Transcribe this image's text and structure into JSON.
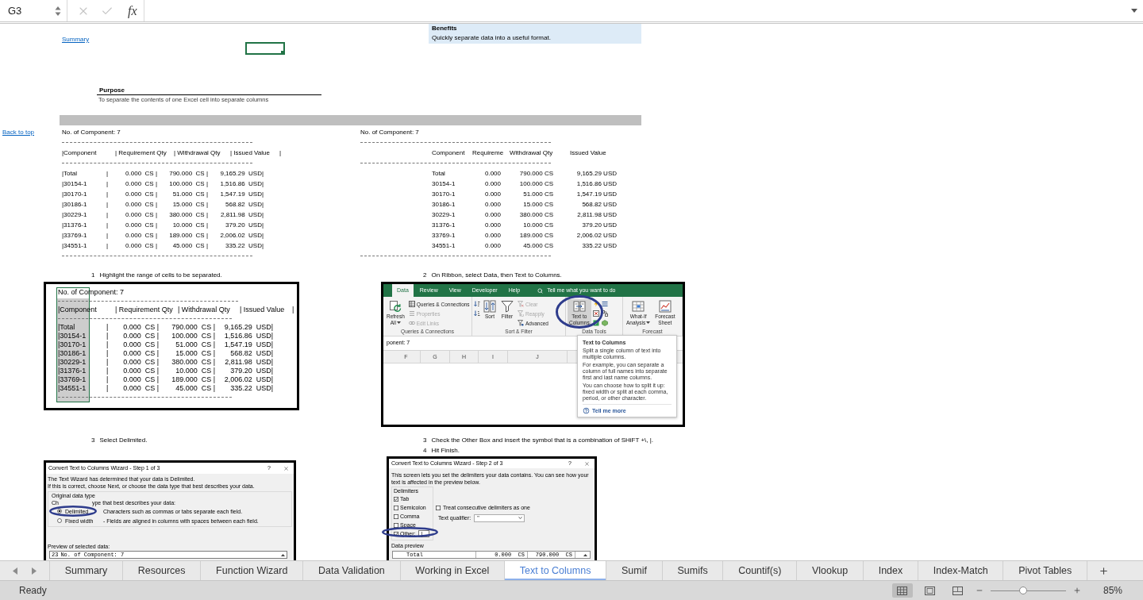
{
  "formula_bar": {
    "name_box": "G3",
    "function_label": "fx"
  },
  "sheet": {
    "summary_link": "Summary",
    "benefits": {
      "title": "Benefits",
      "text": "Quickly separate data into a useful format."
    },
    "purpose": {
      "title": "Purpose",
      "text": "To separate the contents of one Excel cell into separate columns"
    },
    "back_to_top_link": "Back to top",
    "raw_report": {
      "count_line": "No. of Component: 7",
      "header": [
        "|Component",
        "| Requirement Qty",
        "| Withdrawal Qty",
        "| Issued Value",
        "|"
      ],
      "rows": [
        [
          "|Total",
          "|",
          "0.000  CS |",
          "790.000  CS |",
          "9,165.29  USD|"
        ],
        [
          "|30154-1",
          "|",
          "0.000  CS |",
          "100.000  CS |",
          "1,516.86  USD|"
        ],
        [
          "|30170-1",
          "|",
          "0.000  CS |",
          "51.000  CS |",
          "1,547.19  USD|"
        ],
        [
          "|30186-1",
          "|",
          "0.000  CS |",
          "15.000  CS |",
          "568.82  USD|"
        ],
        [
          "|30229-1",
          "|",
          "0.000  CS |",
          "380.000  CS |",
          "2,811.98  USD|"
        ],
        [
          "|31376-1",
          "|",
          "0.000  CS |",
          "10.000  CS |",
          "379.20  USD|"
        ],
        [
          "|33769-1",
          "|",
          "0.000  CS |",
          "189.000  CS |",
          "2,006.02  USD|"
        ],
        [
          "|34551-1",
          "|",
          "0.000  CS |",
          "45.000  CS |",
          "335.22  USD|"
        ]
      ]
    },
    "split_report": {
      "count_line": "No. of Component: 7",
      "header": [
        "Component",
        "Requireme",
        "Withdrawal Qty",
        "Issued Value"
      ],
      "rows": [
        [
          "Total",
          "0.000",
          "790.000 CS",
          "9,165.29 USD"
        ],
        [
          "30154-1",
          "0.000",
          "100.000 CS",
          "1,516.86 USD"
        ],
        [
          "30170-1",
          "0.000",
          "51.000 CS",
          "1,547.19 USD"
        ],
        [
          "30186-1",
          "0.000",
          "15.000 CS",
          "568.82 USD"
        ],
        [
          "30229-1",
          "0.000",
          "380.000 CS",
          "2,811.98 USD"
        ],
        [
          "31376-1",
          "0.000",
          "10.000 CS",
          "379.20 USD"
        ],
        [
          "33769-1",
          "0.000",
          "189.000 CS",
          "2,006.02 USD"
        ],
        [
          "34551-1",
          "0.000",
          "45.000 CS",
          "335.22 USD"
        ]
      ]
    },
    "steps": [
      {
        "lines": [
          {
            "number": "1",
            "text": "Highlight the range of cells to be separated."
          }
        ],
        "screenshot": {
          "kind": "selection",
          "count_line": "No. of Component: 7",
          "header": [
            "|Component",
            "| Requirement Qty",
            "| Withdrawal Qty",
            "| Issued Value",
            "|"
          ],
          "rows": [
            [
              "|Total",
              "|",
              "0.000  CS |",
              "790.000  CS |",
              "9,165.29  USD|"
            ],
            [
              "|30154-1",
              "|",
              "0.000  CS |",
              "100.000  CS |",
              "1,516.86  USD|"
            ],
            [
              "|30170-1",
              "|",
              "0.000  CS |",
              "51.000  CS |",
              "1,547.19  USD|"
            ],
            [
              "|30186-1",
              "|",
              "0.000  CS |",
              "15.000  CS |",
              "568.82  USD|"
            ],
            [
              "|30229-1",
              "|",
              "0.000  CS |",
              "380.000  CS |",
              "2,811.98  USD|"
            ],
            [
              "|31376-1",
              "|",
              "0.000  CS |",
              "10.000  CS |",
              "379.20  USD|"
            ],
            [
              "|33769-1",
              "|",
              "0.000  CS |",
              "189.000  CS |",
              "2,006.02  USD|"
            ],
            [
              "|34551-1",
              "|",
              "0.000  CS |",
              "45.000  CS |",
              "335.22  USD|"
            ]
          ]
        }
      },
      {
        "lines": [
          {
            "number": "2",
            "text": "On Ribbon, select Data, then Text to Columns."
          }
        ],
        "screenshot": {
          "kind": "ribbon",
          "tabs": [
            {
              "label": "Data",
              "selected": true
            },
            {
              "label": "Review",
              "selected": false
            },
            {
              "label": "View",
              "selected": false
            },
            {
              "label": "Developer",
              "selected": false
            },
            {
              "label": "Help",
              "selected": false
            }
          ],
          "search": "Tell me what you want to do",
          "groups": [
            {
              "label": "Queries & Connections",
              "buttons": [
                {
                  "lines": [
                    "Refresh",
                    "All"
                  ],
                  "dropdown": true,
                  "highlighted": false
                }
              ],
              "commands": [
                {
                  "label": "Queries & Connections",
                  "disabled": false
                },
                {
                  "label": "Properties",
                  "disabled": true
                },
                {
                  "label": "Edit Links",
                  "disabled": true
                }
              ]
            },
            {
              "label": "Sort & Filter",
              "buttons": [
                {
                  "lines": [
                    "Sort"
                  ],
                  "dropdown": false,
                  "highlighted": false
                },
                {
                  "lines": [
                    "Filter"
                  ],
                  "dropdown": false,
                  "highlighted": false
                }
              ],
              "commands": [
                {
                  "label": "Clear",
                  "disabled": true
                },
                {
                  "label": "Reapply",
                  "disabled": true
                },
                {
                  "label": "Advanced",
                  "disabled": false
                }
              ]
            },
            {
              "label": "Data Tools",
              "buttons": [
                {
                  "lines": [
                    "Text to",
                    "Columns"
                  ],
                  "dropdown": false,
                  "highlighted": true
                }
              ]
            },
            {
              "label": "Forecast",
              "buttons": [
                {
                  "lines": [
                    "What-If",
                    "Analysis"
                  ],
                  "dropdown": true,
                  "highlighted": false
                },
                {
                  "lines": [
                    "Forecast",
                    "Sheet"
                  ],
                  "dropdown": false,
                  "highlighted": false
                }
              ]
            }
          ],
          "formula_text": "ponent: 7",
          "columns": [
            "F",
            "G",
            "H",
            "I",
            "J"
          ],
          "tooltip": {
            "title": "Text to Columns",
            "paragraphs": [
              "Split a single column of text into multiple columns.",
              "For example, you can separate a column of full names into separate first and last name columns.",
              "You can choose how to split it up: fixed width or split at each comma, period, or other character."
            ],
            "link": "Tell me more"
          }
        }
      },
      {
        "lines": [
          {
            "number": "3",
            "text": "Select Delimited."
          }
        ],
        "screenshot": {
          "kind": "wizard_type",
          "title": "Convert Text to Columns Wizard - Step 1 of 3",
          "help": "?",
          "intro": [
            "The Text Wizard has determined that your data is Delimited.",
            "If this is correct, choose Next, or choose the data type that best describes your data."
          ],
          "group_label": "Original data type",
          "prompt_parts": [
            "Ch",
            "ype that best describes your data:"
          ],
          "options": [
            {
              "label": "Delimited",
              "description": "Characters such as commas or tabs separate each field.",
              "selected": true
            },
            {
              "label": "Fixed width",
              "description": "- Fields are aligned in columns with spaces between each field.",
              "selected": false
            }
          ],
          "preview_label": "Preview of selected data:",
          "preview_rows": [
            {
              "number": "23",
              "text": "No. of Component: 7"
            }
          ]
        }
      },
      {
        "lines": [
          {
            "number": "3",
            "text": "Check the Other Box and insert the symbol that is a combination of SHiFT +\\, |."
          },
          {
            "number": "4",
            "text": "Hit Finish."
          }
        ],
        "screenshot": {
          "kind": "wizard_delimiters",
          "title": "Convert Text to Columns Wizard - Step 2 of 3",
          "help": "?",
          "intro": "This screen lets you set the delimiters your data contains. You can see how your text is affected in the preview below.",
          "group_label": "Delimiters",
          "delimiters": [
            {
              "label": "Tab",
              "checked": true
            },
            {
              "label": "Semicolon",
              "checked": false
            },
            {
              "label": "Comma",
              "checked": false
            },
            {
              "label": "Space",
              "checked": false
            },
            {
              "label": "Other:",
              "checked": true,
              "value": "|"
            }
          ],
          "consecutive": {
            "label": "Treat consecutive delimiters as one",
            "checked": false
          },
          "qualifier": {
            "label": "Text qualifier:",
            "value": "\""
          },
          "preview_label": "Data preview",
          "preview_cells": [
            "Total",
            "0.000  CS",
            "790.000  CS"
          ]
        }
      }
    ]
  },
  "sheet_tabs": [
    {
      "label": "Summary",
      "selected": false
    },
    {
      "label": "Resources",
      "selected": false
    },
    {
      "label": "Function Wizard",
      "selected": false
    },
    {
      "label": "Data Validation",
      "selected": false
    },
    {
      "label": "Working in Excel",
      "selected": false
    },
    {
      "label": "Text to Columns",
      "selected": true
    },
    {
      "label": "Sumif",
      "selected": false
    },
    {
      "label": "Sumifs",
      "selected": false
    },
    {
      "label": "Countif(s)",
      "selected": false
    },
    {
      "label": "Vlookup",
      "selected": false
    },
    {
      "label": "Index",
      "selected": false
    },
    {
      "label": "Index-Match",
      "selected": false
    },
    {
      "label": "Pivot Tables",
      "selected": false
    }
  ],
  "status_bar": {
    "status": "Ready",
    "views": [
      {
        "selected": true
      },
      {
        "selected": false
      },
      {
        "selected": false
      }
    ],
    "zoom": {
      "level": 0.43,
      "reading": "85%"
    }
  }
}
